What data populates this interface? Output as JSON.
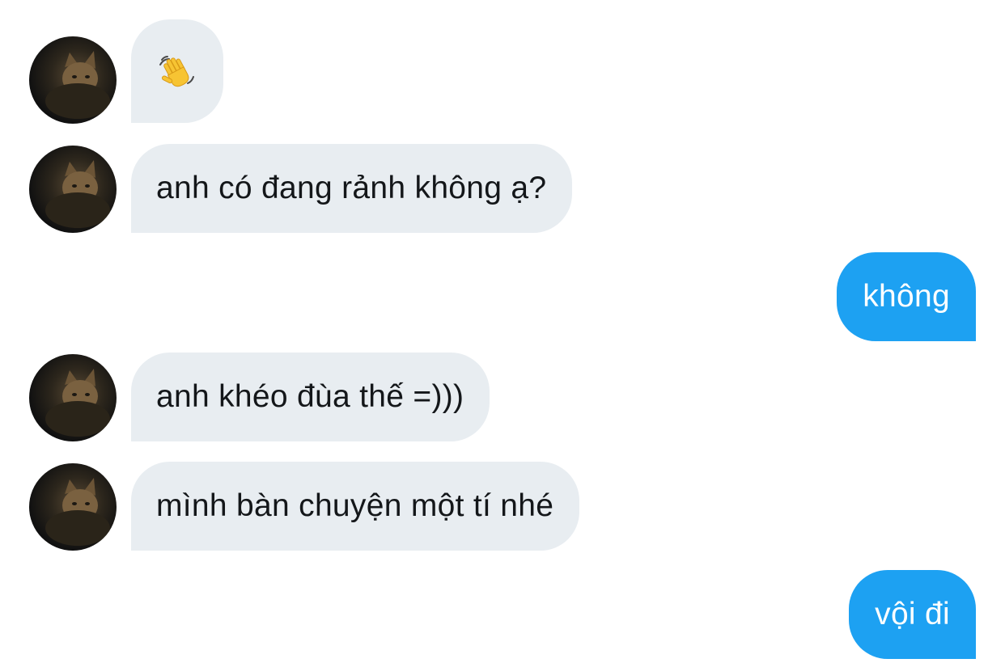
{
  "conversation": {
    "messages": [
      {
        "direction": "incoming",
        "text": "👋",
        "icon": "waving-hand-icon"
      },
      {
        "direction": "incoming",
        "text": "anh có đang rảnh không ạ?"
      },
      {
        "direction": "outgoing",
        "text": "không"
      },
      {
        "direction": "incoming",
        "text": "anh khéo đùa thế =)))"
      },
      {
        "direction": "incoming",
        "text": "mình bàn chuyện một tí nhé"
      },
      {
        "direction": "outgoing",
        "text": "vội đi"
      }
    ]
  },
  "colors": {
    "incoming_bubble": "#e8edf1",
    "outgoing_bubble": "#1da1f2",
    "incoming_text": "#14171a",
    "outgoing_text": "#ffffff"
  },
  "avatar": {
    "icon": "cat-photo-avatar"
  }
}
